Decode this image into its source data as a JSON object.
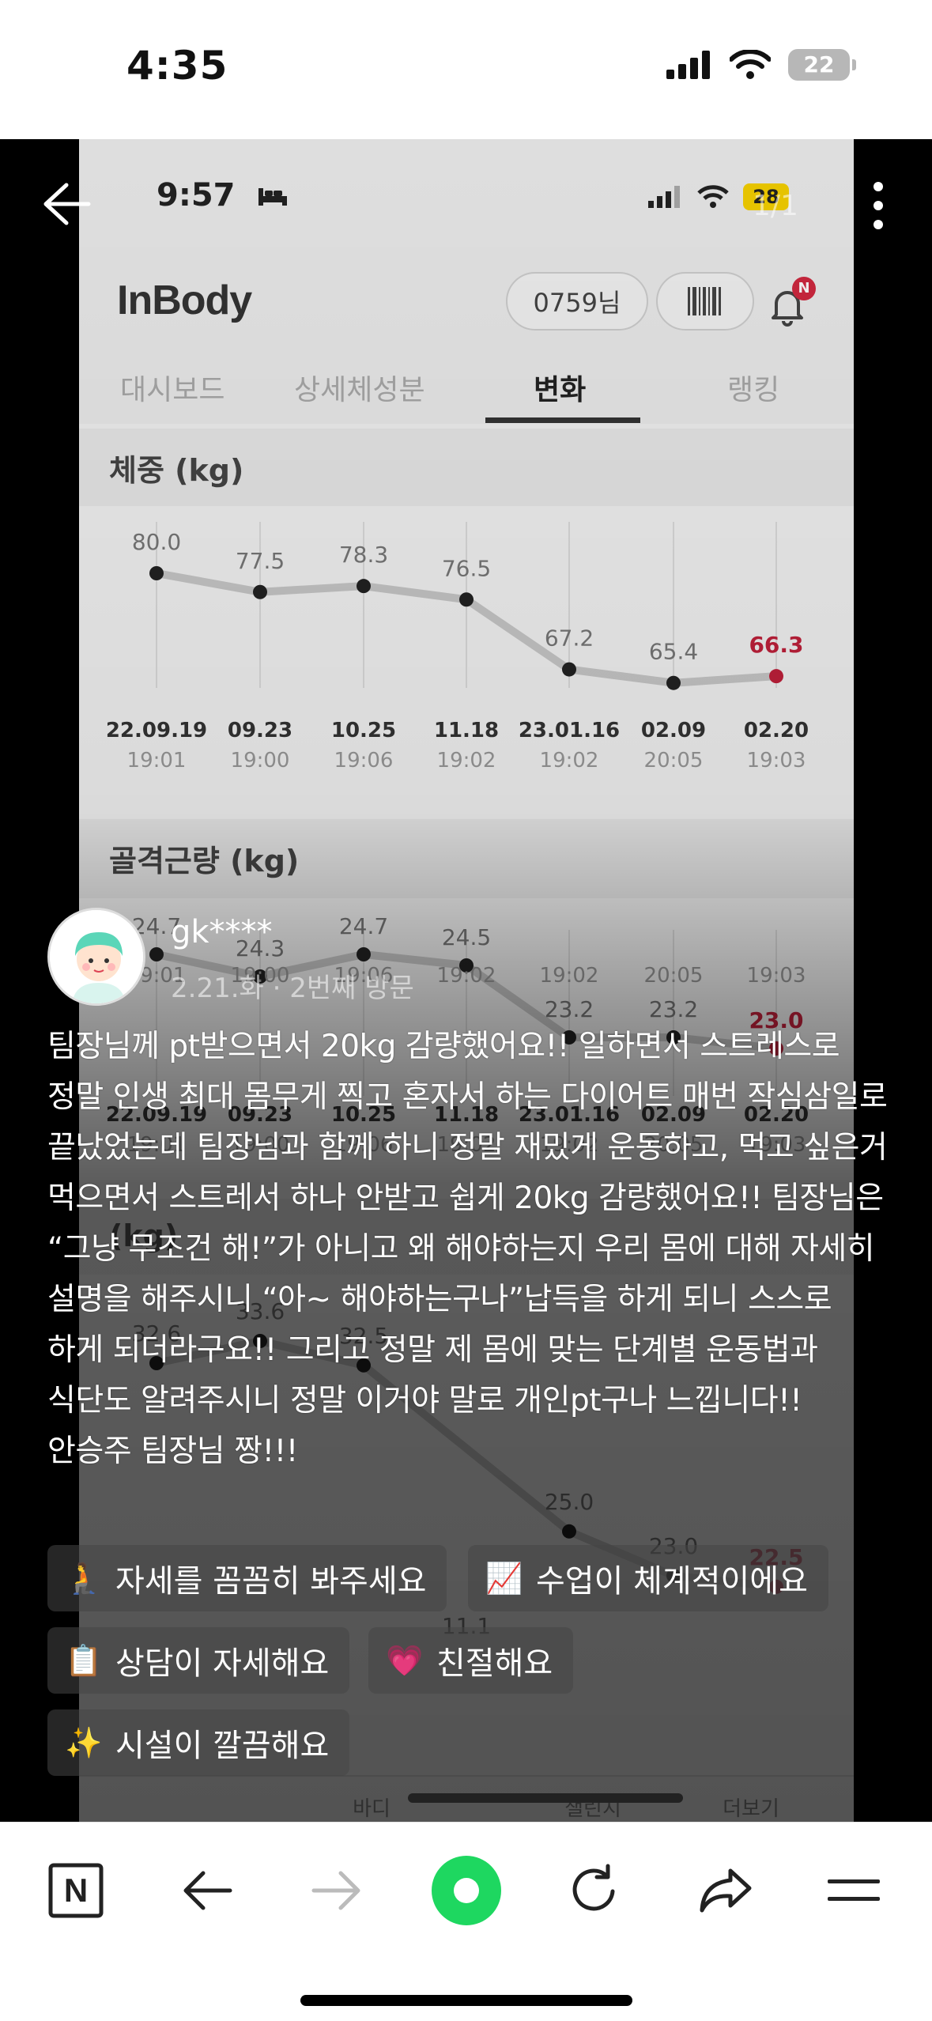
{
  "status_bar": {
    "time": "4:35",
    "battery": "22"
  },
  "viewer": {
    "pager": "1/1"
  },
  "inner_screen": {
    "status_time": "9:57",
    "battery": "28",
    "app_name": "InBody",
    "user_pill": "0759님",
    "notification_badge": "N",
    "tabs": [
      "대시보드",
      "상세체성분",
      "변화",
      "랭킹"
    ],
    "active_tab": 2,
    "weight_title": "체중 (kg)",
    "muscle_title": "골격근량 (kg)",
    "weight_values": [
      "80.0",
      "77.5",
      "78.3",
      "76.5",
      "67.2",
      "65.4",
      "66.3"
    ],
    "dates": [
      "22.09.19",
      "09.23",
      "10.25",
      "11.18",
      "23.01.16",
      "02.09",
      "02.20"
    ],
    "times": [
      "19:01",
      "19:00",
      "19:06",
      "19:02",
      "19:02",
      "20:05",
      "19:03"
    ],
    "muscle_values": [
      "24.7",
      "24.3",
      "24.7",
      "24.5",
      "23.2",
      "23.2",
      "23.0"
    ],
    "fat_values": [
      "32.6",
      "33.6",
      "32.5",
      "25.0",
      "23.0",
      "22.5"
    ],
    "fat_label": "(kg)",
    "ghost_label": "11.1",
    "bottom_nav": [
      "바디",
      "챌린지",
      "더보기"
    ]
  },
  "review": {
    "username": "gk****",
    "meta": "2.21.화 · 2번째 방문",
    "text": "팀장님께 pt받으면서 20kg 감량했어요!! 일하면서 스트레스로 정말 인생 최대 몸무게 찍고 혼자서 하는 다이어트 매번 작심삼일로 끝났었는데 팀장님과 함께 하니 정말 재밌게 운동하고, 먹고 싶은거 먹으면서 스트레서 하나 안받고 쉽게 20kg 감량했어요!! 팀장님은 “그냥 무조건 해!”가 아니고 왜 해야하는지 우리 몸에 대해 자세히 설명을 해주시니 “아~ 해야하는구나”납득을 하게 되니 스스로 하게 되더라구요!! 그리고 정말 제 몸에 맞는 단계별 운동법과 식단도 알려주시니 정말 이거야 말로 개인pt구나 느낍니다!! 안승주 팀장님 짱!!!",
    "tags": [
      {
        "emoji": "🧎",
        "label": "자세를 꼼꼼히 봐주세요"
      },
      {
        "emoji": "📈",
        "label": "수업이 체계적이에요"
      },
      {
        "emoji": "📋",
        "label": "상담이 자세해요"
      },
      {
        "emoji": "💗",
        "label": "친절해요"
      },
      {
        "emoji": "✨",
        "label": "시설이 깔끔해요"
      }
    ]
  },
  "browser": {
    "n_label": "N"
  },
  "colors": {
    "accent_green": "#1ed760",
    "highlight_red": "#c0203a",
    "dark_bg": "#000000"
  }
}
